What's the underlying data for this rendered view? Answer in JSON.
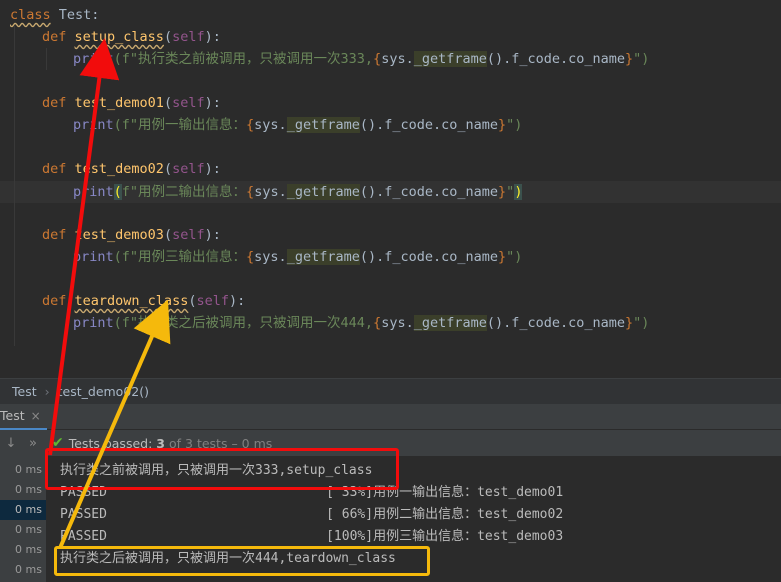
{
  "code": {
    "class_line": {
      "kw": "class",
      "name": "Test:"
    },
    "methods": [
      {
        "def": "def",
        "name": "setup_class",
        "params": "self",
        "print_kw": "print",
        "fstr_prefix": "(f\"",
        "text": "执行类之前被调用，只被调用一次333,",
        "sys": "sys.",
        "getframe": "_getframe",
        "tail": "().f_code.co_name",
        "close": "\")"
      },
      {
        "def": "def",
        "name": "test_demo01",
        "params": "self",
        "print_kw": "print",
        "fstr_prefix": "(f\"",
        "text": "用例一输出信息：",
        "sys": "sys.",
        "getframe": "_getframe",
        "tail": "().f_code.co_name",
        "close": "\")"
      },
      {
        "def": "def",
        "name": "test_demo02",
        "params": "self",
        "print_kw": "print",
        "fstr_prefix": "(f\"",
        "text": "用例二输出信息：",
        "sys": "sys.",
        "getframe": "_getframe",
        "tail": "().f_code.co_name",
        "close": "\")"
      },
      {
        "def": "def",
        "name": "test_demo03",
        "params": "self",
        "print_kw": "print",
        "fstr_prefix": "(f\"",
        "text": "用例三输出信息：",
        "sys": "sys.",
        "getframe": "_getframe",
        "tail": "().f_code.co_name",
        "close": "\")"
      },
      {
        "def": "def",
        "name": "teardown_class",
        "params": "self",
        "print_kw": "print",
        "fstr_prefix": "(f\"",
        "text": "执行类之后被调用，只被调用一次444,",
        "sys": "sys.",
        "getframe": "_getframe",
        "tail": "().f_code.co_name",
        "close": "\")"
      }
    ]
  },
  "breadcrumb": {
    "class": "Test",
    "method": "test_demo02()"
  },
  "run_tab": {
    "label": "Test",
    "close": "×"
  },
  "toolbar": {
    "status_main": "Tests passed:",
    "status_count": "3",
    "status_rest": "of 3 tests – 0 ms"
  },
  "tree_times": [
    "0 ms",
    "0 ms",
    "0 ms",
    "0 ms",
    "0 ms",
    "0 ms"
  ],
  "console_lines": [
    "执行类之前被调用，只被调用一次333,setup_class",
    "PASSED                            [ 33%]用例一输出信息：test_demo01",
    "PASSED                            [ 66%]用例二输出信息：test_demo02",
    "PASSED                            [100%]用例三输出信息：test_demo03",
    "执行类之后被调用，只被调用一次444,teardown_class"
  ],
  "colors": {
    "annotation_red": "#f20c0c",
    "annotation_orange": "#f5b90c",
    "pass_green": "#5fb832"
  }
}
